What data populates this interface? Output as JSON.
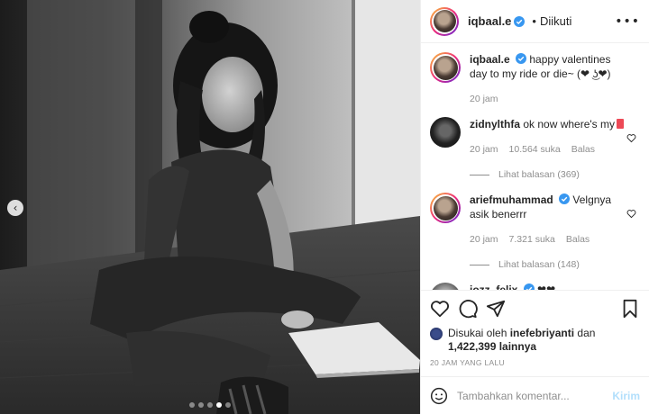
{
  "post": {
    "author": "iqbaal.e",
    "follow_sep": "•",
    "follow_status": "Diikuti",
    "more": "•••"
  },
  "caption": {
    "user": "iqbaal.e",
    "text": "happy valentines day to my ride or die~ (❤ ͜ʖ❤)",
    "time": "20 jam"
  },
  "comments": [
    {
      "user": "zidnylthfa",
      "text": "ok now where's my",
      "time": "20 jam",
      "likes": "10.564 suka",
      "reply": "Balas",
      "view_replies": "Lihat balasan (369)"
    },
    {
      "user": "ariefmuhammad",
      "text": "Velgnya asik benerrr",
      "time": "20 jam",
      "likes": "7.321 suka",
      "reply": "Balas",
      "view_replies": "Lihat balasan (148)"
    },
    {
      "user": "jozz_felix",
      "text": "❤❤"
    }
  ],
  "likes": {
    "prefix": "Disukai oleh",
    "user": "inefebriyanti",
    "and": "dan",
    "count": "1,422,399 lainnya"
  },
  "posted_ago": "20 JAM YANG LALU",
  "composer": {
    "placeholder": "Tambahkan komentar...",
    "send_label": "Kirim"
  },
  "carousel": {
    "total": 5,
    "active_index": 3,
    "prev_glyph": "‹"
  },
  "colors": {
    "verified": "#3897f0",
    "link_disabled": "#b2dffc",
    "heart": "#ed4956"
  }
}
